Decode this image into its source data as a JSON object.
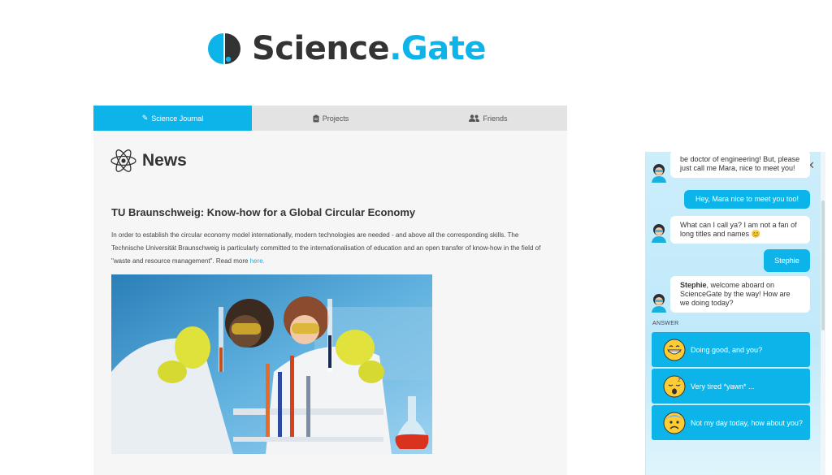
{
  "logo": {
    "word1": "Science",
    "dot": ".",
    "word2": "Gate"
  },
  "tabs": [
    {
      "label": "Science Journal",
      "icon": "pencil-icon",
      "active": true
    },
    {
      "label": "Projects",
      "icon": "clipboard-icon",
      "active": false
    },
    {
      "label": "Friends",
      "icon": "users-icon",
      "active": false
    }
  ],
  "news": {
    "heading": "News",
    "icon": "atom-icon",
    "article_title": "TU Braunschweig: Know-how for a Global Circular Economy",
    "article_body": "In order to establish the circular economy model internationally, modern technologies are needed - and above all the corresponding skills. The Technische Universität Braunschweig is particularly committed to the internationalisation of education and an open transfer of know-how in the field of \"waste and resource management\". Read more ",
    "read_more_link": "here."
  },
  "chat": {
    "messages": [
      {
        "from": "bot",
        "text": "be doctor of engineering! But, please just call me Mara, nice to meet you!"
      },
      {
        "from": "user",
        "text": "Hey, Mara nice to meet you too!"
      },
      {
        "from": "bot",
        "text": "What can I call ya? I am not a fan of long titles and names 😊"
      },
      {
        "from": "user",
        "text": "Stephie"
      },
      {
        "from": "bot",
        "name": "Stephie",
        "text": ", welcome aboard on ScienceGate by the way! How are we doing today?"
      }
    ],
    "answer_label": "ANSWER",
    "answers": [
      {
        "label": "Doing good, and you?",
        "icon": "grinning-emoji-icon"
      },
      {
        "label": "Very tired *yawn* ...",
        "icon": "sleeping-emoji-icon"
      },
      {
        "label": "Not my day today, how about you?",
        "icon": "anxious-emoji-icon"
      }
    ]
  },
  "colors": {
    "accent": "#0db4ea",
    "dark": "#333333"
  }
}
